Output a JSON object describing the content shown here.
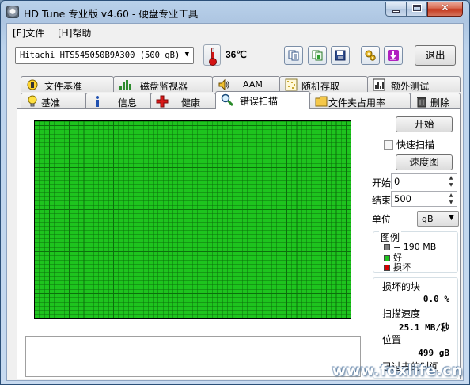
{
  "window": {
    "title": "HD Tune 专业版 v4.60 - 硬盘专业工具",
    "minimize_label": "minimize",
    "maximize_label": "maximize",
    "close_glyph": "✕"
  },
  "menu": {
    "items": [
      {
        "label": "[F]文件"
      },
      {
        "label": "[H]帮助"
      }
    ]
  },
  "toolbar": {
    "drive": "Hitachi HTS545050B9A300  (500 gB)",
    "temperature": "36℃",
    "icons": [
      "copy-text-icon",
      "copy-info-icon",
      "save-icon",
      "options-icon",
      "screenshot-icon"
    ],
    "exit_label": "退出"
  },
  "tabs": {
    "row1": [
      {
        "label": "文件基准",
        "icon": "file-benchmark-icon"
      },
      {
        "label": "磁盘监视器",
        "icon": "disk-monitor-icon"
      },
      {
        "label": "AAM",
        "icon": "speaker-icon"
      },
      {
        "label": "随机存取",
        "icon": "random-access-icon"
      },
      {
        "label": "额外测试",
        "icon": "extra-tests-icon"
      }
    ],
    "row2": [
      {
        "label": "基准",
        "icon": "benchmark-icon"
      },
      {
        "label": "信息",
        "icon": "info-icon"
      },
      {
        "label": "健康",
        "icon": "health-icon"
      },
      {
        "label": "错误扫描",
        "icon": "error-scan-icon",
        "active": true
      },
      {
        "label": "文件夹占用率",
        "icon": "folder-usage-icon"
      },
      {
        "label": "删除",
        "icon": "erase-icon"
      }
    ]
  },
  "error_scan": {
    "start_button": "开始",
    "quick_scan_label": "快速扫描",
    "quick_scan_checked": false,
    "speed_map_button": "速度图",
    "start_label": "开始",
    "start_value": "0",
    "end_label": "结束",
    "end_value": "500",
    "unit_label": "单位",
    "unit_value": "gB",
    "legend": {
      "title": "图例",
      "block_size": "= 190 MB",
      "good": "好",
      "bad": "损坏",
      "block_color": "#808080",
      "good_color": "#1ec41e",
      "bad_color": "#d40000"
    },
    "stats": {
      "damaged_blocks_label": "损坏的块",
      "damaged_blocks_value": "0.0 %",
      "scan_speed_label": "扫描速度",
      "scan_speed_value": "25.1 MB/秒",
      "position_label": "位置",
      "position_value": "499 gB",
      "elapsed_label": "已过去的时间"
    },
    "grid_status": "all blocks good"
  },
  "watermark": "www.foxlife.cn"
}
